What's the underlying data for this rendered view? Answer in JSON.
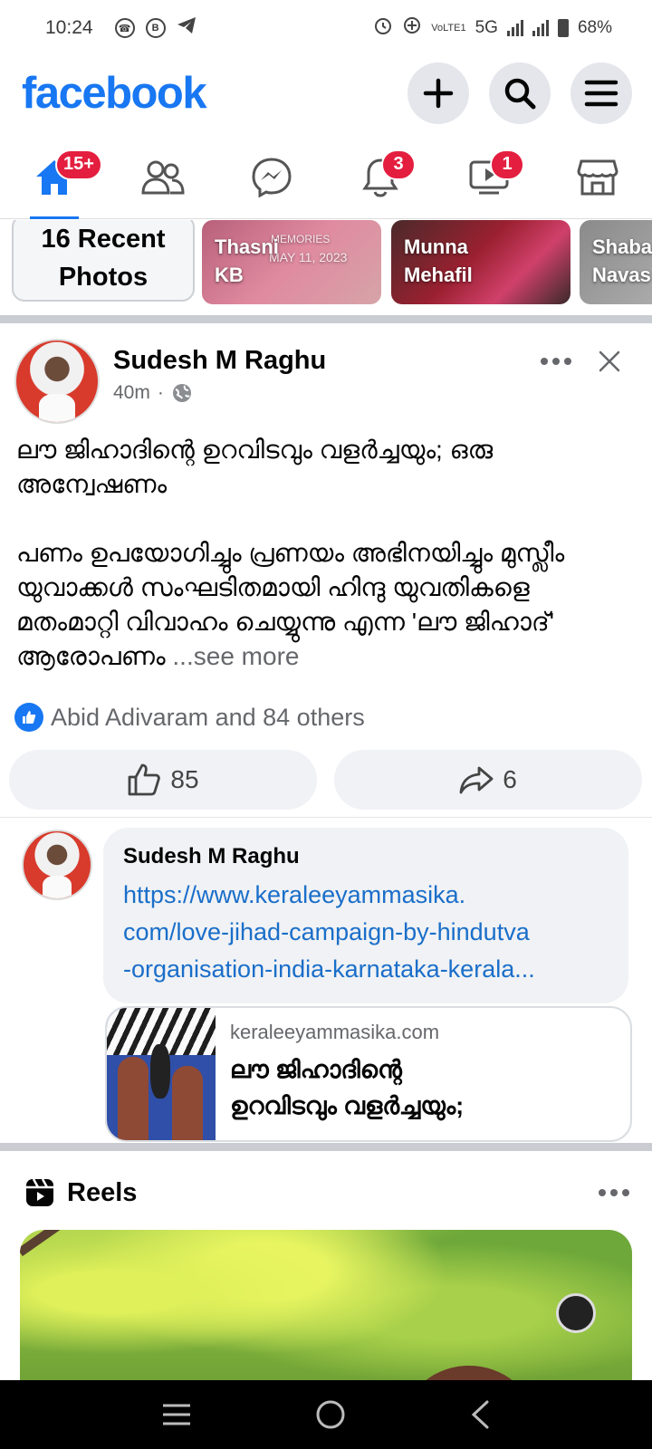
{
  "status_bar": {
    "time": "10:24",
    "network": "5G",
    "volte": "VoLTE1",
    "battery": "68%"
  },
  "header": {
    "logo": "facebook",
    "actions": [
      "create-icon",
      "search-icon",
      "menu-icon"
    ]
  },
  "nav": {
    "tabs": [
      {
        "name": "home",
        "icon": "home-icon",
        "badge": "15+",
        "active": true
      },
      {
        "name": "friends",
        "icon": "friends-icon",
        "badge": ""
      },
      {
        "name": "messenger",
        "icon": "messenger-icon",
        "badge": ""
      },
      {
        "name": "notifications",
        "icon": "bell-icon",
        "badge": "3"
      },
      {
        "name": "video",
        "icon": "video-icon",
        "badge": "1"
      },
      {
        "name": "marketplace",
        "icon": "marketplace-icon",
        "badge": ""
      }
    ]
  },
  "memories": {
    "recent_label": "16 Recent Photos",
    "recent_line1": "16 Recent",
    "recent_line2": "Photos",
    "cards": [
      {
        "line1": "Thasni",
        "line2": "KB",
        "overlay": "MEMORIES",
        "date": "MAY 11, 2023"
      },
      {
        "line1": "Munna",
        "line2": "Mehafil"
      },
      {
        "line1": "Shaba",
        "line2": "Navas"
      }
    ]
  },
  "post": {
    "author": "Sudesh M Raghu",
    "time": "40m",
    "dot": "·",
    "text_para1": "ലൗ ജിഹാദിന്റെ ഉറവിടവും വളർച്ചയും; ഒരു അന്വേഷണം",
    "text_para2": "പണം ഉപയോഗിച്ചും പ്രണയം അഭിനയിച്ചും മുസ്ലീം യുവാക്കൾ സംഘടിതമായി ഹിന്ദു യുവതികളെ മതംമാറ്റി വിവാഹം ചെയ്യുന്നു എന്ന 'ലൗ ജിഹാദ്' ആരോപണം",
    "see_more": "...see more",
    "reactions_text": "Abid Adivaram and 84 others",
    "like_count": "85",
    "share_count": "6"
  },
  "comment": {
    "author": "Sudesh M Raghu",
    "link": "https://www.keraleeyammasika.com/love-jihad-campaign-by-hindutva-organisation-india-karnataka-kerala...",
    "link_line1": "https://www.keraleeyammasika.",
    "link_line2": "com/love-jihad-campaign-by-hindutva",
    "link_line3": "-organisation-india-karnataka-kerala...",
    "preview": {
      "domain": "keraleeyammasika.com",
      "title_line1": "ലൗ ജിഹാദിന്റെ",
      "title_line2": "ഉറവിടവും വളർച്ചയും;"
    }
  },
  "reels": {
    "title": "Reels"
  },
  "colors": {
    "brand": "#1877f2",
    "badge": "#e41e3f",
    "link": "#1a6ec9",
    "muted": "#65676b",
    "pill_bg": "#f0f2f5"
  }
}
